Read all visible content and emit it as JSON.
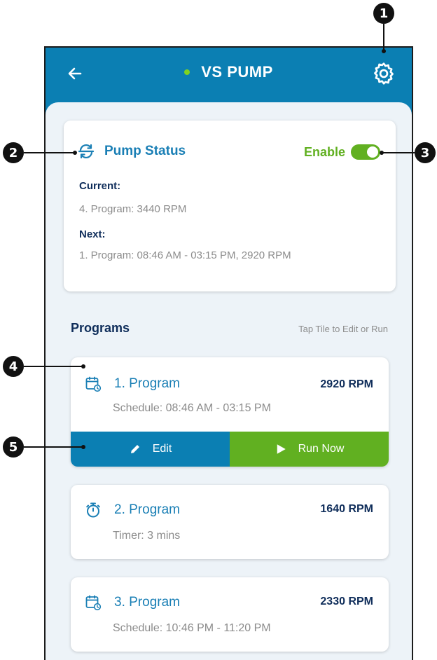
{
  "header": {
    "title": "VS PUMP",
    "status_color": "#7ed321",
    "back_icon": "arrow-left-icon",
    "settings_icon": "gear-icon"
  },
  "pump_status": {
    "title": "Pump Status",
    "icon": "sync-icon",
    "enable_label": "Enable",
    "enabled": true,
    "current_label": "Current:",
    "current_value": "4. Program: 3440 RPM",
    "next_label": "Next:",
    "next_value": "1. Program: 08:46 AM - 03:15 PM, 2920 RPM"
  },
  "programs": {
    "title": "Programs",
    "hint": "Tap Tile to Edit or Run",
    "items": [
      {
        "name": "1. Program",
        "rpm": "2920 RPM",
        "detail": "Schedule: 08:46 AM - 03:15 PM",
        "icon": "calendar-clock-icon"
      },
      {
        "name": "2. Program",
        "rpm": "1640 RPM",
        "detail": "Timer: 3 mins",
        "icon": "stopwatch-icon"
      },
      {
        "name": "3. Program",
        "rpm": "2330 RPM",
        "detail": "Schedule: 10:46 PM - 11:20 PM",
        "icon": "calendar-clock-icon"
      }
    ],
    "actions": {
      "edit_label": "Edit",
      "run_label": "Run Now"
    }
  },
  "callouts": [
    "1",
    "2",
    "3",
    "4",
    "5"
  ],
  "colors": {
    "primary": "#0b7fb3",
    "accent_green": "#61b021",
    "navy": "#0f2d5a",
    "background": "#edf3f8"
  }
}
